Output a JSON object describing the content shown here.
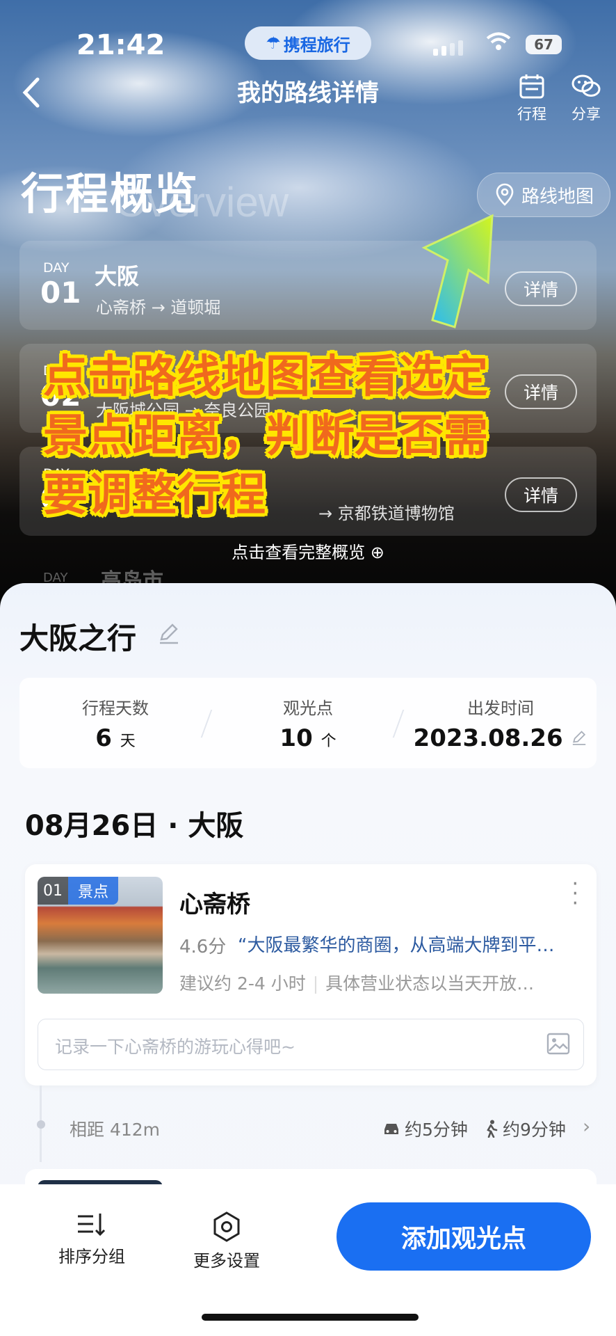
{
  "status_bar": {
    "time": "21:42",
    "app_badge": "携程旅行",
    "battery": "67"
  },
  "nav": {
    "title": "我的路线详情",
    "trip_label": "行程",
    "share_label": "分享"
  },
  "overview": {
    "title": "行程概览",
    "subtitle": "Overview",
    "map_button": "路线地图",
    "days": [
      {
        "day_label": "DAY",
        "day_num": "01",
        "city": "大阪",
        "route": "心斋桥 → 道顿堀",
        "detail": "详情"
      },
      {
        "day_label": "DAY",
        "day_num": "02",
        "city": "",
        "route": "大阪城公园 → 奈良公园",
        "detail": "详情"
      },
      {
        "day_label": "DAY",
        "day_num": "03",
        "city": "京都",
        "route": "→ 京都铁道博物馆",
        "detail": "详情"
      }
    ],
    "view_all": "点击查看完整概览",
    "next_day_label": "DAY",
    "next_city": "高岛市"
  },
  "annotation_lines": [
    "点击路线地图查看选定",
    "景点距离，判断是否需",
    "要调整行程"
  ],
  "trip": {
    "name": "大阪之行",
    "stats": [
      {
        "label": "行程天数",
        "value": "6",
        "unit": "天"
      },
      {
        "label": "观光点",
        "value": "10",
        "unit": "个"
      },
      {
        "label": "出发时间",
        "value": "2023.08.26",
        "unit": ""
      }
    ]
  },
  "schedule": {
    "date_header": "08月26日 · 大阪",
    "spots": [
      {
        "index": "01",
        "kind": "景点",
        "name": "心斋桥",
        "score": "4.6分",
        "quote": "“大阪最繁华的商圈，从高端大牌到平…",
        "suggestion": "建议约 2-4 小时",
        "hours": "具体营业状态以当天开放…",
        "note_placeholder": "记录一下心斋桥的游玩心得吧~"
      }
    ],
    "transit": {
      "distance": "相距 412m",
      "drive": "约5分钟",
      "walk": "约9分钟"
    }
  },
  "bottom": {
    "sort_label": "排序分组",
    "settings_label": "更多设置",
    "add_label": "添加观光点"
  },
  "colors": {
    "accent": "#1a6ff2",
    "annotation_fill": "#f0691d",
    "annotation_outline": "#ffe600"
  }
}
